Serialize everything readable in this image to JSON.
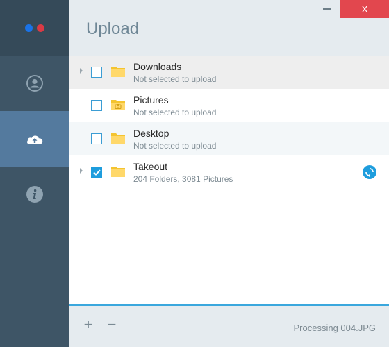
{
  "app": {
    "title": "Upload",
    "close_label": "X",
    "logo_colors": [
      "#1a73e8",
      "#d93a45"
    ],
    "accent": "#1e9ddd"
  },
  "sidebar": {
    "items": [
      {
        "name": "account",
        "icon": "account-icon",
        "active": false
      },
      {
        "name": "upload",
        "icon": "cloud-upload-icon",
        "active": true
      },
      {
        "name": "info",
        "icon": "info-icon",
        "active": false
      }
    ]
  },
  "folders": [
    {
      "name": "Downloads",
      "status": "Not selected to upload",
      "checked": false,
      "expandable": true,
      "icon": "folder-icon"
    },
    {
      "name": "Pictures",
      "status": "Not selected to upload",
      "checked": false,
      "expandable": false,
      "icon": "camera-folder-icon"
    },
    {
      "name": "Desktop",
      "status": "Not selected to upload",
      "checked": false,
      "expandable": false,
      "icon": "folder-icon"
    },
    {
      "name": "Takeout",
      "status": "204 Folders, 3081 Pictures",
      "checked": true,
      "expandable": true,
      "icon": "folder-icon",
      "syncing": true
    }
  ],
  "footer": {
    "add_label": "+",
    "remove_label": "−",
    "status": "Processing 004.JPG"
  }
}
